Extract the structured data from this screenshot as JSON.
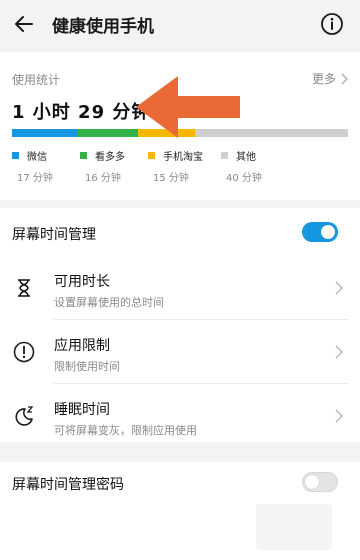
{
  "header": {
    "title": "健康使用手机",
    "back_icon": "back-arrow-icon",
    "info_icon": "info-icon"
  },
  "usage": {
    "label": "使用统计",
    "more_label": "更多",
    "total_time": "1 小时 29 分钟",
    "apps": [
      {
        "name": "微信",
        "duration": "17 分钟",
        "color": "#1497e0",
        "minutes": 17
      },
      {
        "name": "看多多",
        "duration": "16 分钟",
        "color": "#33b24a",
        "minutes": 16
      },
      {
        "name": "手机淘宝",
        "duration": "15 分钟",
        "color": "#f5b800",
        "minutes": 15
      },
      {
        "name": "其他",
        "duration": "40 分钟",
        "color": "#cfcfcf",
        "minutes": 40
      }
    ]
  },
  "annotation": {
    "arrow_color": "#e96a36"
  },
  "management": {
    "title": "屏幕时间管理",
    "toggle_on": true,
    "items": [
      {
        "title": "可用时长",
        "subtitle": "设置屏幕使用的总时间",
        "icon": "hourglass-icon"
      },
      {
        "title": "应用限制",
        "subtitle": "限制使用时间",
        "icon": "alert-circle-icon"
      },
      {
        "title": "睡眠时间",
        "subtitle": "可将屏幕变灰，限制应用使用",
        "icon": "moon-sleep-icon"
      }
    ]
  },
  "password": {
    "title": "屏幕时间管理密码",
    "toggle_on": false
  },
  "colors": {
    "accent": "#1497e0",
    "background": "#f1f3f5"
  }
}
